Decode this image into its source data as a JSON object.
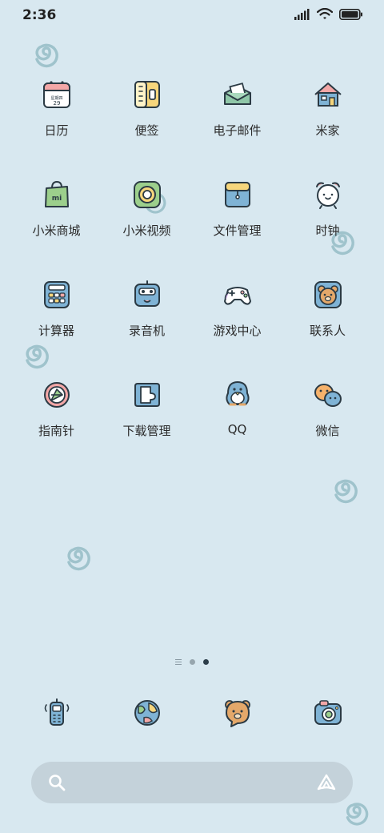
{
  "status_bar": {
    "time": "2:36"
  },
  "apps": [
    {
      "label": "日历",
      "icon": "calendar-icon",
      "icon_text_top": "星期四",
      "icon_text_day": "29"
    },
    {
      "label": "便签",
      "icon": "notes-icon"
    },
    {
      "label": "电子邮件",
      "icon": "email-icon"
    },
    {
      "label": "米家",
      "icon": "home-icon"
    },
    {
      "label": "小米商城",
      "icon": "shopping-bag-icon"
    },
    {
      "label": "小米视频",
      "icon": "video-icon"
    },
    {
      "label": "文件管理",
      "icon": "folder-icon"
    },
    {
      "label": "时钟",
      "icon": "alarm-clock-icon"
    },
    {
      "label": "计算器",
      "icon": "calculator-icon"
    },
    {
      "label": "录音机",
      "icon": "recorder-icon"
    },
    {
      "label": "游戏中心",
      "icon": "gamepad-icon"
    },
    {
      "label": "联系人",
      "icon": "bear-contact-icon"
    },
    {
      "label": "指南针",
      "icon": "compass-icon"
    },
    {
      "label": "下载管理",
      "icon": "download-icon"
    },
    {
      "label": "QQ",
      "icon": "penguin-icon"
    },
    {
      "label": "微信",
      "icon": "chat-bubbles-icon"
    }
  ],
  "pager": {
    "pages": 2,
    "active": 2
  },
  "dock": [
    {
      "icon": "phone-icon"
    },
    {
      "icon": "browser-globe-icon"
    },
    {
      "icon": "bear-messages-icon"
    },
    {
      "icon": "camera-icon"
    }
  ],
  "colors": {
    "background": "#d8e8f0",
    "search_bar": "#c4d2da",
    "swirl": "#9fc3cc"
  }
}
